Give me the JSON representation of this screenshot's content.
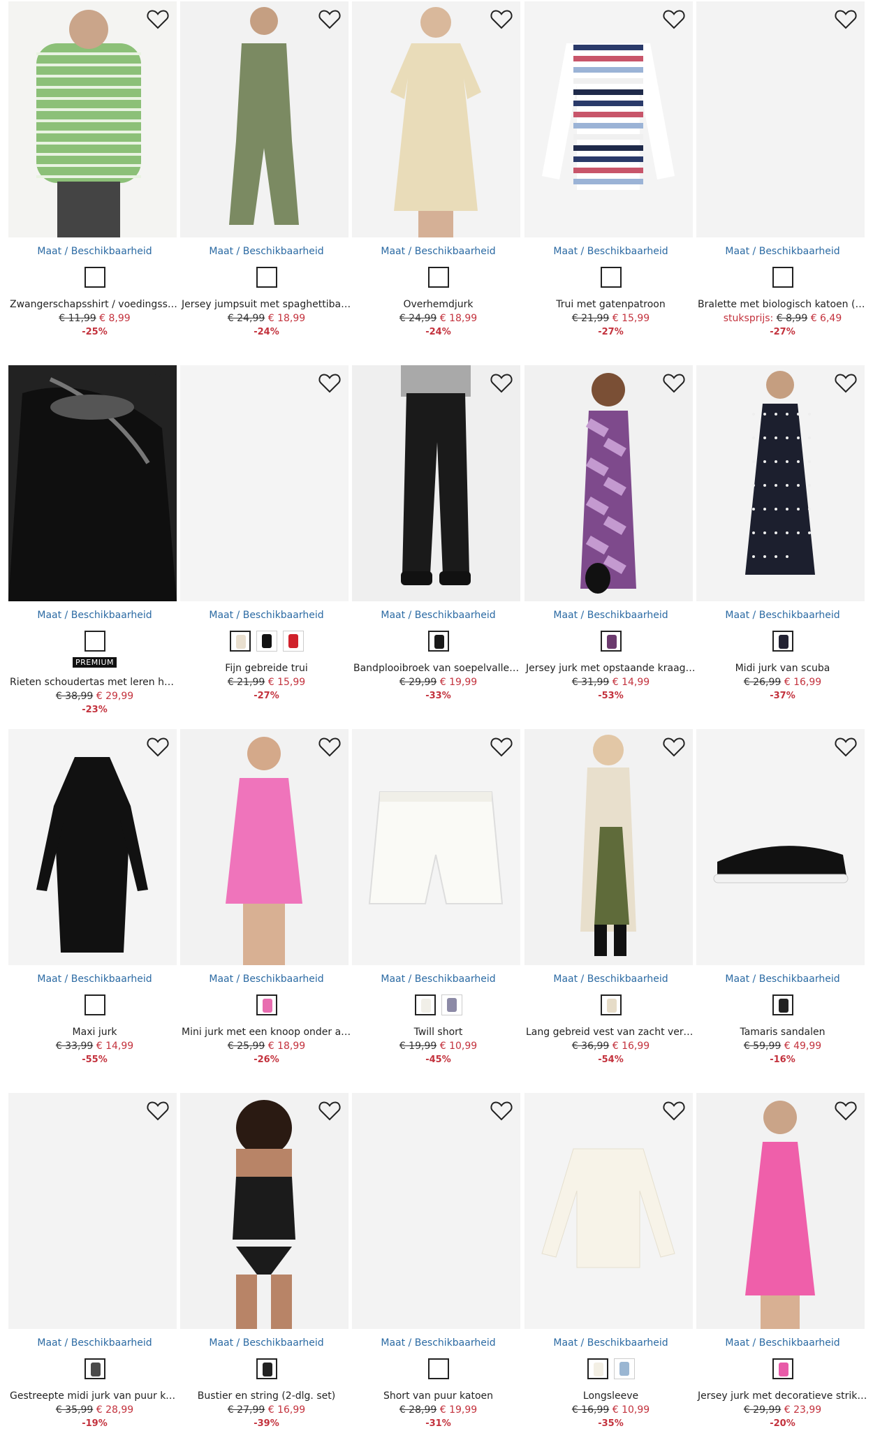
{
  "common": {
    "size_link": "Maat / Beschikbaarheid",
    "fav_icon": "heart-outline-icon"
  },
  "colors": {
    "link": "#2b6aa3",
    "sale": "#c3323d"
  },
  "products": [
    {
      "name": "Zwangerschapsshirt / voedingsshirt…",
      "old_price": "€ 11,99",
      "new_price": "€ 8,99",
      "discount": "-25%",
      "swatches": [
        "#ffffff"
      ],
      "image": "green-striped-shirt",
      "bg": "#f4f4f2"
    },
    {
      "name": "Jersey jumpsuit met spaghettiband…",
      "old_price": "€ 24,99",
      "new_price": "€ 18,99",
      "discount": "-24%",
      "swatches": [
        "#ffffff"
      ],
      "image": "olive-jumpsuit",
      "bg": "#f2f2f2"
    },
    {
      "name": "Overhemdjurk",
      "old_price": "€ 24,99",
      "new_price": "€ 18,99",
      "discount": "-24%",
      "swatches": [
        "#ffffff"
      ],
      "image": "beige-shirt-dress",
      "bg": "#f3f3f3"
    },
    {
      "name": "Trui met gatenpatroon",
      "old_price": "€ 21,99",
      "new_price": "€ 15,99",
      "discount": "-27%",
      "swatches": [
        "#ffffff"
      ],
      "image": "striped-knit-sweater",
      "bg": "#f4f4f4"
    },
    {
      "name": "Bralette met biologisch katoen (set…",
      "unit_label": "stuksprijs:",
      "old_price": "€ 8,99",
      "new_price": "€ 6,49",
      "discount": "-27%",
      "swatches": [
        "#ffffff"
      ],
      "image": "empty",
      "bg": "#f3f3f3"
    },
    {
      "name": "Rieten schoudertas met leren heng…",
      "badge": "PREMIUM",
      "old_price": "€ 38,99",
      "new_price": "€ 29,99",
      "discount": "-23%",
      "swatches": [
        "#ffffff"
      ],
      "image": "black-straw-bag",
      "bg": "#1b1b1b"
    },
    {
      "name": "Fijn gebreide trui",
      "old_price": "€ 21,99",
      "new_price": "€ 15,99",
      "discount": "-27%",
      "swatches": [
        "#e9dfcf",
        "#111111",
        "#d0212b"
      ],
      "image": "empty",
      "bg": "#f4f4f4"
    },
    {
      "name": "Bandplooibroek van soepelvallende…",
      "old_price": "€ 29,99",
      "new_price": "€ 19,99",
      "discount": "-33%",
      "swatches": [
        "#1a1a1a"
      ],
      "image": "black-trousers",
      "bg": "#efefef"
    },
    {
      "name": "Jersey jurk met opstaande kraag en…",
      "old_price": "€ 31,99",
      "new_price": "€ 14,99",
      "discount": "-53%",
      "swatches": [
        "#6b3a6e"
      ],
      "image": "purple-print-dress",
      "bg": "#f1f1f1"
    },
    {
      "name": "Midi jurk van scuba",
      "old_price": "€ 26,99",
      "new_price": "€ 16,99",
      "discount": "-37%",
      "swatches": [
        "#222233"
      ],
      "image": "polka-dot-dress",
      "bg": "#f3f3f3"
    },
    {
      "name": "Maxi jurk",
      "old_price": "€ 33,99",
      "new_price": "€ 14,99",
      "discount": "-55%",
      "swatches": [
        "#ffffff"
      ],
      "image": "black-maxi-dress",
      "bg": "#f4f4f4"
    },
    {
      "name": "Mini jurk met een knoop onder aan …",
      "old_price": "€ 25,99",
      "new_price": "€ 18,99",
      "discount": "-26%",
      "swatches": [
        "#e86db0"
      ],
      "image": "pink-mini-dress",
      "bg": "#f2f2f2"
    },
    {
      "name": "Twill short",
      "old_price": "€ 19,99",
      "new_price": "€ 10,99",
      "discount": "-45%",
      "swatches": [
        "#f1efe8",
        "#8c8aa6"
      ],
      "image": "white-shorts",
      "bg": "#f4f4f4"
    },
    {
      "name": "Lang gebreid vest van zacht vereng…",
      "old_price": "€ 36,99",
      "new_price": "€ 16,99",
      "discount": "-54%",
      "swatches": [
        "#e6dcc8"
      ],
      "image": "long-cardigan",
      "bg": "#f2f2f2"
    },
    {
      "name": "Tamaris sandalen",
      "old_price": "€ 59,99",
      "new_price": "€ 49,99",
      "discount": "-16%",
      "swatches": [
        "#222222"
      ],
      "image": "black-sandal",
      "bg": "#f4f4f4"
    },
    {
      "name": "Gestreepte midi jurk van puur katoen",
      "old_price": "€ 35,99",
      "new_price": "€ 28,99",
      "discount": "-19%",
      "swatches": [
        "#4a4a4a"
      ],
      "image": "empty",
      "bg": "#f3f3f3"
    },
    {
      "name": "Bustier en string (2-dlg. set)",
      "old_price": "€ 27,99",
      "new_price": "€ 16,99",
      "discount": "-39%",
      "swatches": [
        "#222222"
      ],
      "image": "black-lace-bustier",
      "bg": "#f2f2f2"
    },
    {
      "name": "Short van puur katoen",
      "old_price": "€ 28,99",
      "new_price": "€ 19,99",
      "discount": "-31%",
      "swatches": [
        "#ffffff"
      ],
      "image": "empty",
      "bg": "#f3f3f3"
    },
    {
      "name": "Longsleeve",
      "old_price": "€ 16,99",
      "new_price": "€ 10,99",
      "discount": "-35%",
      "swatches": [
        "#f3efe4",
        "#9ab6d2"
      ],
      "image": "cream-longsleeve",
      "bg": "#f4f4f4"
    },
    {
      "name": "Jersey jurk met decoratieve strik a…",
      "old_price": "€ 29,99",
      "new_price": "€ 23,99",
      "discount": "-20%",
      "swatches": [
        "#e85aa8"
      ],
      "image": "pink-slip-dress",
      "bg": "#f2f2f2"
    }
  ]
}
